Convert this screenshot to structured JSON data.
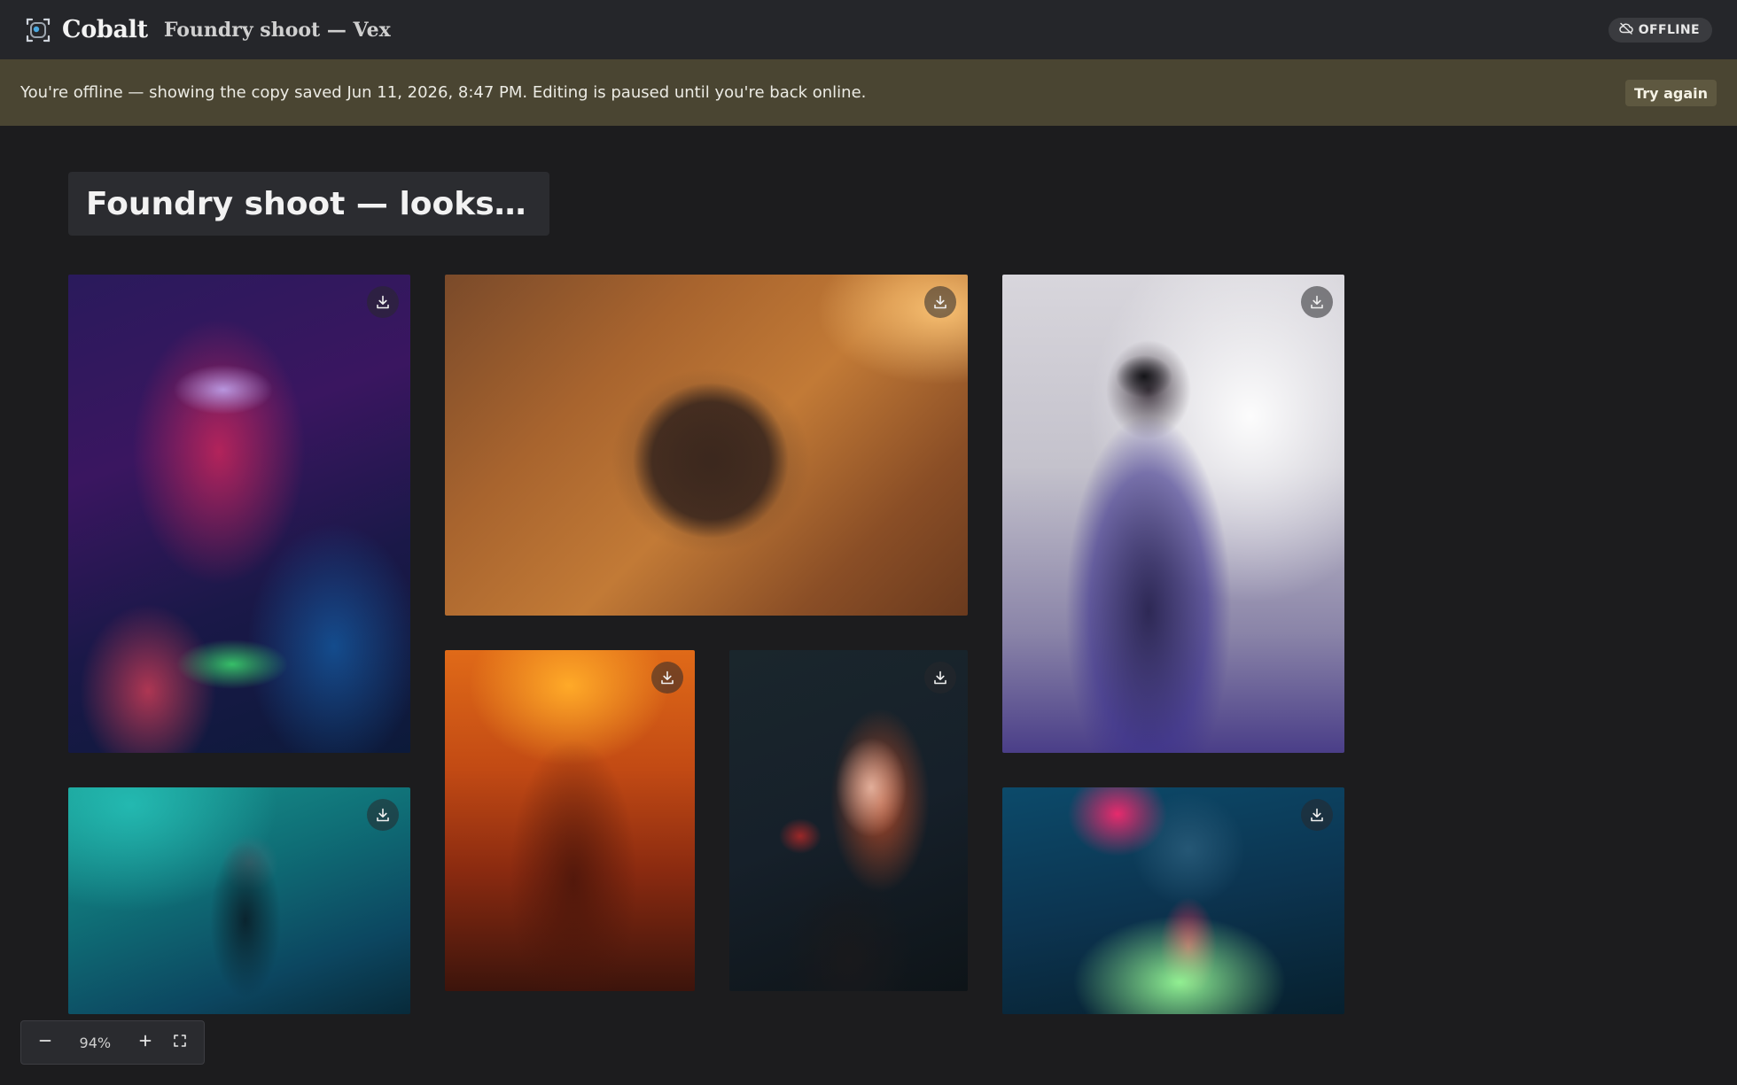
{
  "header": {
    "brand": "Cobalt",
    "doc_title": "Foundry shoot — Vex",
    "status_badge": "OFFLINE"
  },
  "banner": {
    "message": "You're offline — showing the copy saved Jun 11, 2026, 8:47 PM. Editing is paused until you're back online.",
    "retry_label": "Try again"
  },
  "board": {
    "title": "Foundry shoot — looks…",
    "photos": [
      {
        "id": "photo-neon-axe",
        "icon": "download-icon"
      },
      {
        "id": "photo-rusted-window",
        "icon": "download-icon"
      },
      {
        "id": "photo-hat-silhouette",
        "icon": "download-icon"
      },
      {
        "id": "photo-orange-profile",
        "icon": "download-icon"
      },
      {
        "id": "photo-red-hair-glass",
        "icon": "download-icon"
      },
      {
        "id": "photo-teal-braids",
        "icon": "download-icon"
      },
      {
        "id": "photo-neon-jacket",
        "icon": "download-icon"
      }
    ]
  },
  "zoom": {
    "level": "94%",
    "icons": [
      "minus-icon",
      "plus-icon",
      "fullscreen-icon"
    ]
  },
  "colors": {
    "topbar": "#25262a",
    "banner": "#4a4532",
    "background": "#1c1c1e",
    "accent": "#4aa8e0"
  }
}
